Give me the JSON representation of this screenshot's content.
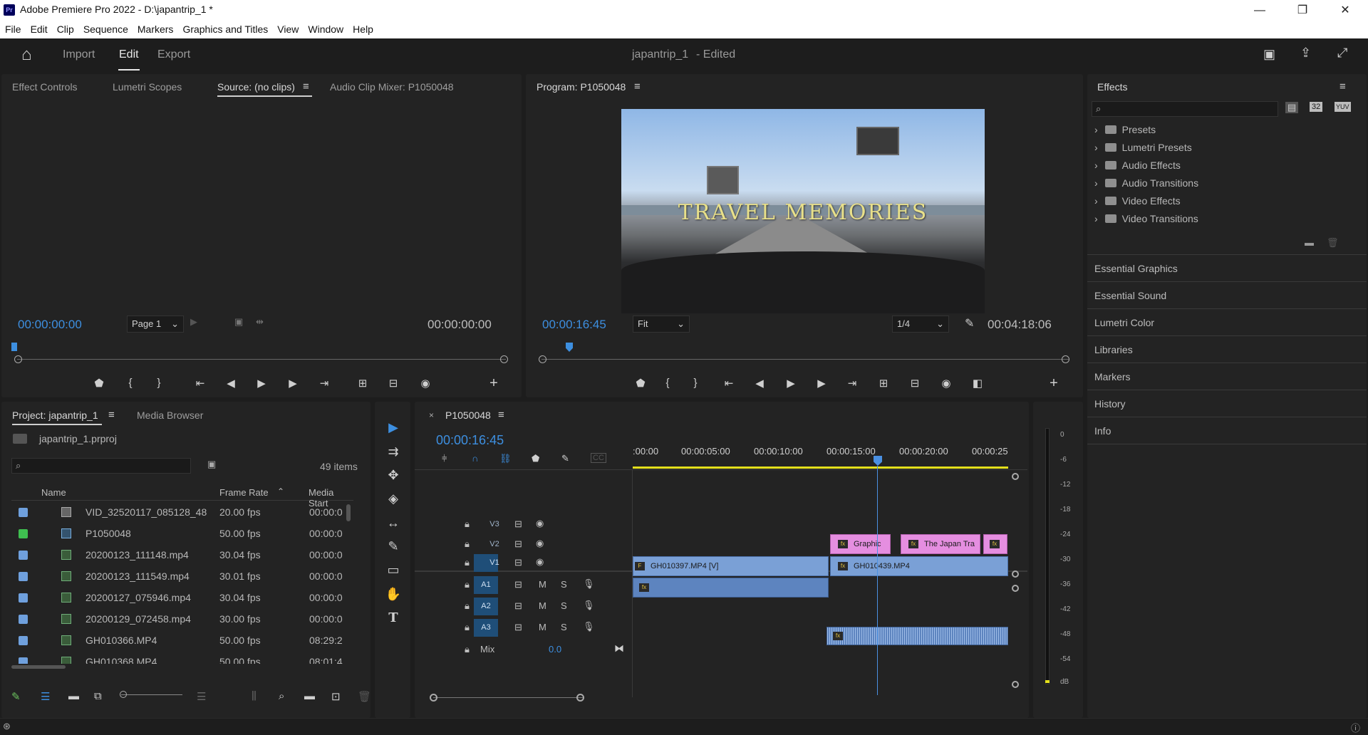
{
  "window": {
    "title": "Adobe Premiere Pro 2022 - D:\\japantrip_1 *",
    "logo": "Pr",
    "minimize": "—",
    "restore": "❐",
    "close": "✕"
  },
  "menu": [
    "File",
    "Edit",
    "Clip",
    "Sequence",
    "Markers",
    "Graphics and Titles",
    "View",
    "Window",
    "Help"
  ],
  "header": {
    "tabs": [
      "Import",
      "Edit",
      "Export"
    ],
    "active_tab": "Edit",
    "doc_title": "japantrip_1",
    "doc_status": "- Edited"
  },
  "source_panel": {
    "tabs": [
      "Effect Controls",
      "Lumetri Scopes",
      "Source: (no clips)",
      "Audio Clip Mixer: P1050048"
    ],
    "active_tab": "Source: (no clips)",
    "timecode_in": "00:00:00:00",
    "page_select": "Page 1",
    "timecode_out": "00:00:00:00"
  },
  "program_panel": {
    "title": "Program: P1050048",
    "overlay_title": "Travel  Memories",
    "timecode": "00:00:16:45",
    "zoom": "Fit",
    "resolution": "1/4",
    "duration": "00:04:18:06"
  },
  "effects_panel": {
    "title": "Effects",
    "search_placeholder": "",
    "folders": [
      "Presets",
      "Lumetri Presets",
      "Audio Effects",
      "Audio Transitions",
      "Video Effects",
      "Video Transitions"
    ],
    "badges": [
      "32",
      "YUV"
    ],
    "links": [
      "Essential Graphics",
      "Essential Sound",
      "Lumetri Color",
      "Libraries",
      "Markers",
      "History",
      "Info"
    ]
  },
  "project_panel": {
    "tabs": [
      "Project: japantrip_1",
      "Media Browser"
    ],
    "file": "japantrip_1.prproj",
    "item_count": "49 items",
    "columns": [
      "Name",
      "Frame Rate",
      "Media Start"
    ],
    "rows": [
      {
        "name": "VID_32520117_085128_48",
        "fps": "20.00 fps",
        "start": "00:00:0",
        "color": "#6fa0dd"
      },
      {
        "name": "P1050048",
        "fps": "50.00 fps",
        "start": "00:00:0",
        "color": "#3fbf50"
      },
      {
        "name": "20200123_111148.mp4",
        "fps": "30.04 fps",
        "start": "00:00:0",
        "color": "#6fa0dd"
      },
      {
        "name": "20200123_111549.mp4",
        "fps": "30.01 fps",
        "start": "00:00:0",
        "color": "#6fa0dd"
      },
      {
        "name": "20200127_075946.mp4",
        "fps": "30.04 fps",
        "start": "00:00:0",
        "color": "#6fa0dd"
      },
      {
        "name": "20200129_072458.mp4",
        "fps": "30.00 fps",
        "start": "00:00:0",
        "color": "#6fa0dd"
      },
      {
        "name": "GH010366.MP4",
        "fps": "50.00 fps",
        "start": "08:29:2",
        "color": "#6fa0dd"
      },
      {
        "name": "GH010368.MP4",
        "fps": "50.00 fps",
        "start": "08:01:4",
        "color": "#6fa0dd"
      }
    ]
  },
  "timeline": {
    "sequence": "P1050048",
    "timecode": "00:00:16:45",
    "ruler": [
      ":00:00",
      "00:00:05:00",
      "00:00:10:00",
      "00:00:15:00",
      "00:00:20:00",
      "00:00:25"
    ],
    "tracks": {
      "video": [
        "V3",
        "V2",
        "V1"
      ],
      "audio": [
        "A1",
        "A2",
        "A3"
      ]
    },
    "track_buttons": {
      "mute": "M",
      "solo": "S"
    },
    "mix_label": "Mix",
    "mix_value": "0.0",
    "clips": {
      "v2_a": "Graphic",
      "v2_b": "The Japan Tra",
      "v1_a": "GH010397.MP4 [V]",
      "v1_b": "GH010439.MP4",
      "fx": "fx",
      "f": "F"
    }
  },
  "meter": {
    "labels": [
      "0",
      "-6",
      "-12",
      "-18",
      "-24",
      "-30",
      "-36",
      "-42",
      "-48",
      "-54",
      "dB"
    ]
  },
  "tools": [
    {
      "name": "selection-tool",
      "glyph": "▶"
    },
    {
      "name": "track-select-tool",
      "glyph": "⇉"
    },
    {
      "name": "ripple-edit-tool",
      "glyph": "✥"
    },
    {
      "name": "razor-tool",
      "glyph": "◈"
    },
    {
      "name": "slip-tool",
      "glyph": "↔"
    },
    {
      "name": "pen-tool",
      "glyph": "✎"
    },
    {
      "name": "rectangle-tool",
      "glyph": "▭"
    },
    {
      "name": "hand-tool",
      "glyph": "✋"
    },
    {
      "name": "type-tool",
      "glyph": "T"
    }
  ],
  "colors": {
    "accent_blue": "#3d8fe0",
    "playhead": "#4a90e2",
    "work_area": "#e4e01c",
    "clip_video": "#7aa0d6",
    "clip_graphic": "#e58ee0"
  }
}
